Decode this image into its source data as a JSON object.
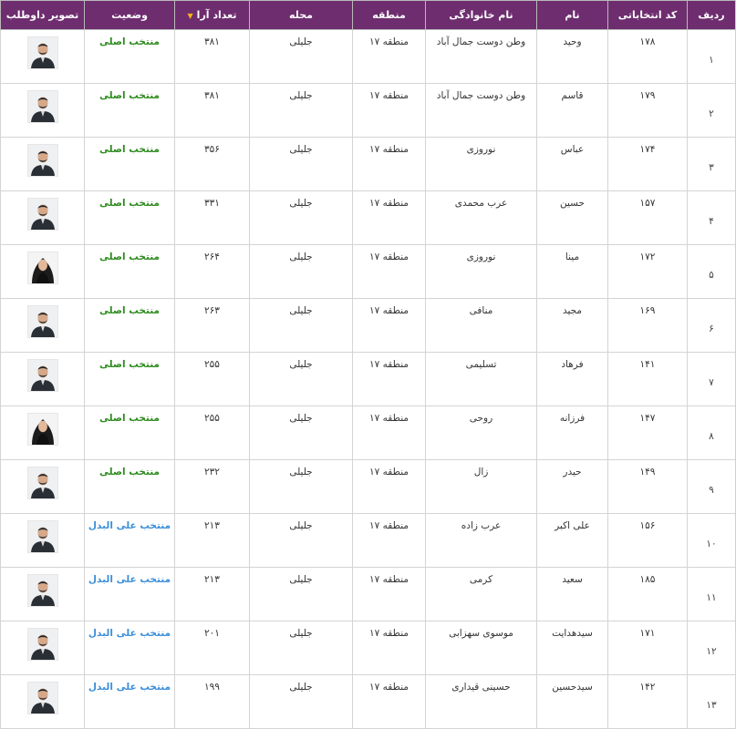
{
  "table": {
    "headers": {
      "row": "ردیف",
      "code": "کد انتخاباتی",
      "first_name": "نام",
      "last_name": "نام خانوادگی",
      "district": "منطقه",
      "neighborhood": "محله",
      "votes": "تعداد آرا",
      "status": "وضعیت",
      "photo": "تصویر داوطلب"
    },
    "colors": {
      "header_bg": "#6e2d6f",
      "status_main": "#2e8b1f",
      "status_alt": "#3b8fd9",
      "sort_arrow": "#f2b21b"
    },
    "rows": [
      {
        "row": "۱",
        "code": "۱۷۸",
        "first_name": "وحید",
        "last_name": "وطن دوست جمال آباد",
        "district": "منطقه ۱۷",
        "neighborhood": "جلیلی",
        "votes": "۳۸۱",
        "status": "منتخب اصلی",
        "status_type": "main",
        "avatar": "male"
      },
      {
        "row": "۲",
        "code": "۱۷۹",
        "first_name": "قاسم",
        "last_name": "وطن دوست جمال آباد",
        "district": "منطقه ۱۷",
        "neighborhood": "جلیلی",
        "votes": "۳۸۱",
        "status": "منتخب اصلی",
        "status_type": "main",
        "avatar": "male"
      },
      {
        "row": "۳",
        "code": "۱۷۴",
        "first_name": "عباس",
        "last_name": "نوروزی",
        "district": "منطقه ۱۷",
        "neighborhood": "جلیلی",
        "votes": "۳۵۶",
        "status": "منتخب اصلی",
        "status_type": "main",
        "avatar": "male"
      },
      {
        "row": "۴",
        "code": "۱۵۷",
        "first_name": "حسین",
        "last_name": "عرب محمدی",
        "district": "منطقه ۱۷",
        "neighborhood": "جلیلی",
        "votes": "۳۳۱",
        "status": "منتخب اصلی",
        "status_type": "main",
        "avatar": "male"
      },
      {
        "row": "۵",
        "code": "۱۷۲",
        "first_name": "مینا",
        "last_name": "نوروزی",
        "district": "منطقه ۱۷",
        "neighborhood": "جلیلی",
        "votes": "۲۶۴",
        "status": "منتخب اصلی",
        "status_type": "main",
        "avatar": "female"
      },
      {
        "row": "۶",
        "code": "۱۶۹",
        "first_name": "مجید",
        "last_name": "منافی",
        "district": "منطقه ۱۷",
        "neighborhood": "جلیلی",
        "votes": "۲۶۳",
        "status": "منتخب اصلی",
        "status_type": "main",
        "avatar": "male"
      },
      {
        "row": "۷",
        "code": "۱۴۱",
        "first_name": "فرهاد",
        "last_name": "تسلیمی",
        "district": "منطقه ۱۷",
        "neighborhood": "جلیلی",
        "votes": "۲۵۵",
        "status": "منتخب اصلی",
        "status_type": "main",
        "avatar": "male"
      },
      {
        "row": "۸",
        "code": "۱۴۷",
        "first_name": "فرزانه",
        "last_name": "روحی",
        "district": "منطقه ۱۷",
        "neighborhood": "جلیلی",
        "votes": "۲۵۵",
        "status": "منتخب اصلی",
        "status_type": "main",
        "avatar": "female"
      },
      {
        "row": "۹",
        "code": "۱۴۹",
        "first_name": "حیدر",
        "last_name": "زال",
        "district": "منطقه ۱۷",
        "neighborhood": "جلیلی",
        "votes": "۲۳۲",
        "status": "منتخب اصلی",
        "status_type": "main",
        "avatar": "male"
      },
      {
        "row": "۱۰",
        "code": "۱۵۶",
        "first_name": "علی اکبر",
        "last_name": "عرب زاده",
        "district": "منطقه ۱۷",
        "neighborhood": "جلیلی",
        "votes": "۲۱۳",
        "status": "منتخب علی البدل",
        "status_type": "alt",
        "avatar": "male"
      },
      {
        "row": "۱۱",
        "code": "۱۸۵",
        "first_name": "سعید",
        "last_name": "کرمی",
        "district": "منطقه ۱۷",
        "neighborhood": "جلیلی",
        "votes": "۲۱۳",
        "status": "منتخب علی البدل",
        "status_type": "alt",
        "avatar": "male"
      },
      {
        "row": "۱۲",
        "code": "۱۷۱",
        "first_name": "سیدهدایت",
        "last_name": "موسوی سهزابی",
        "district": "منطقه ۱۷",
        "neighborhood": "جلیلی",
        "votes": "۲۰۱",
        "status": "منتخب علی البدل",
        "status_type": "alt",
        "avatar": "male"
      },
      {
        "row": "۱۳",
        "code": "۱۴۲",
        "first_name": "سیدحسین",
        "last_name": "حسینی قیداری",
        "district": "منطقه ۱۷",
        "neighborhood": "جلیلی",
        "votes": "۱۹۹",
        "status": "منتخب علی البدل",
        "status_type": "alt",
        "avatar": "male"
      }
    ]
  }
}
